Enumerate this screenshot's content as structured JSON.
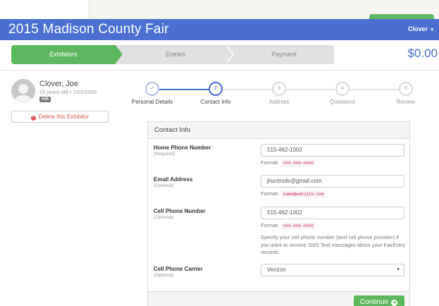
{
  "header": {
    "title": "2015 Madison County Fair",
    "user_menu": "Clover",
    "user_caret": "▾"
  },
  "steps": {
    "exhibitors": "Exhibitors",
    "entries": "Entries",
    "payment": "Payment",
    "total": "$0.00"
  },
  "exhibitor": {
    "name": "Clover, Joe",
    "details": "15 years old • 1/01/2000",
    "badge": "#45",
    "delete_label": "Delete this Exhibitor",
    "delete_icon": "x-circle-icon"
  },
  "wizard": {
    "steps": [
      {
        "num": "✓",
        "label": "Personal Details",
        "state": "done"
      },
      {
        "num": "2",
        "label": "Contact Info",
        "state": "current"
      },
      {
        "num": "3",
        "label": "Address",
        "state": "todo"
      },
      {
        "num": "4",
        "label": "Questions",
        "state": "todo"
      },
      {
        "num": "5",
        "label": "Review",
        "state": "todo"
      }
    ]
  },
  "contact": {
    "panel_title": "Contact Info",
    "format_label": "Format:",
    "home_phone": {
      "label": "Home Phone Number",
      "sub": "(Required)",
      "value": "515-462-1002",
      "format": "###-###-####"
    },
    "email": {
      "label": "Email Address",
      "sub": "(Optional)",
      "value": "jhuntrods@gmail.com",
      "format": "name@website.com"
    },
    "cell_phone": {
      "label": "Cell Phone Number",
      "sub": "(Optional)",
      "value": "515-462-1002",
      "format": "###-###-####"
    },
    "cell_help": "Specify your cell phone number (and cell phone provider) if you want to receive SMS Text messages about your FairEntry records.",
    "carrier": {
      "label": "Cell Phone Carrier",
      "sub": "(Optional)",
      "value": "Verizon",
      "caret": "▾"
    },
    "continue_label": "Continue",
    "continue_icon": "➜"
  },
  "colors": {
    "brand": "#4d6fd1",
    "success": "#5cb85c",
    "danger": "#d9534f"
  }
}
